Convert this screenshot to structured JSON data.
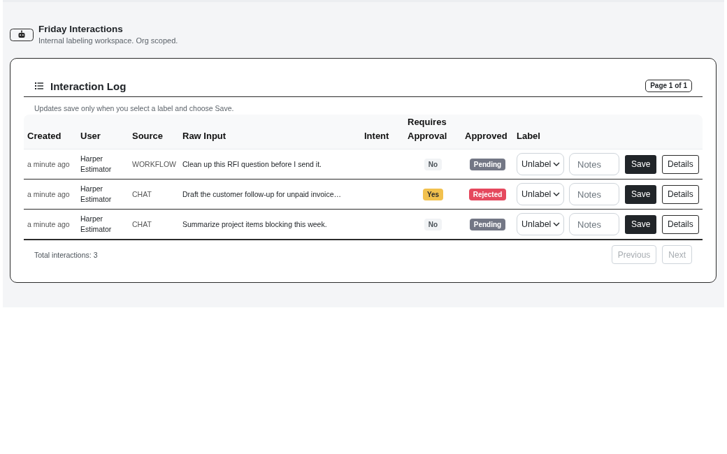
{
  "header": {
    "title": "Friday Interactions",
    "subtitle": "Internal labeling workspace. Org scoped."
  },
  "log": {
    "title": "Interaction Log",
    "page_indicator": "Page 1 of 1",
    "note": "Updates save only when you select a label and choose Save.",
    "table": {
      "columns": [
        "Created",
        "User",
        "Source",
        "Raw Input",
        "Intent",
        "Requires Approval",
        "Approved",
        "Label"
      ],
      "rows": [
        {
          "created": "a minute ago",
          "user": "Harper Estimator",
          "source": "WORKFLOW",
          "raw_input": "Clean up this RFI question before I send it.",
          "requires_approval": {
            "text": "No",
            "color": "#f1f3f5"
          },
          "approved": {
            "text": "Pending",
            "color": "#737785"
          },
          "label": {
            "value": "Unlabel"
          },
          "notes": {
            "placeholder": "Notes"
          },
          "save": "Save",
          "details": "Details"
        },
        {
          "created": "a minute ago",
          "user": "Harper Estimator",
          "source": "CHAT",
          "raw_input": "Draft the customer follow-up for unpaid invoice…",
          "requires_approval": {
            "text": "Yes",
            "color": "#f2c14e"
          },
          "approved": {
            "text": "Rejected",
            "color": "#e5485d"
          },
          "label": {
            "value": "Unlabel"
          },
          "notes": {
            "placeholder": "Notes"
          },
          "save": "Save",
          "details": "Details"
        },
        {
          "created": "a minute ago",
          "user": "Harper Estimator",
          "source": "CHAT",
          "raw_input": "Summarize project items blocking this week.",
          "requires_approval": {
            "text": "No",
            "color": "#f1f3f5"
          },
          "approved": {
            "text": "Pending",
            "color": "#737785"
          },
          "label": {
            "value": "Unlabel"
          },
          "notes": {
            "placeholder": "Notes"
          },
          "save": "Save",
          "details": "Details"
        }
      ]
    },
    "total": "Total interactions: 3",
    "pagination": [
      {
        "label": "Previous",
        "disabled": true
      },
      {
        "label": "Next",
        "disabled": true
      }
    ]
  }
}
